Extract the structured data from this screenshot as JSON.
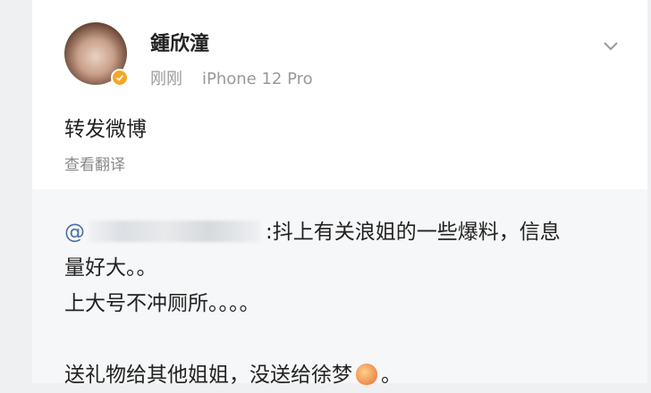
{
  "post": {
    "author": "鍾欣潼",
    "time": "刚刚",
    "device": "iPhone 12 Pro",
    "repost_text": "转发微博",
    "translate_label": "查看翻译"
  },
  "quoted": {
    "mention_prefix": "@",
    "line1_after": ":抖上有关浪姐的一些爆料，信息",
    "line2": "量好大。。",
    "line3": "上大号不冲厕所。。。。",
    "line5_before": "送礼物给其他姐姐，没送给徐梦",
    "line5_after": "。"
  },
  "colors": {
    "verify_badge": "#f5a623",
    "mention": "#4b6fa3",
    "meta_gray": "#999999"
  },
  "icons": {
    "avatar": "avatar-image",
    "verify": "verified-badge-icon",
    "menu": "chevron-down-icon",
    "emoji": "peach-emoji-icon"
  }
}
